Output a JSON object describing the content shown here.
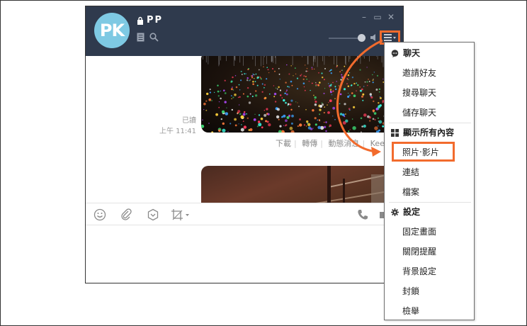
{
  "window": {
    "avatar_text": "PK",
    "title": "PP",
    "minimize": "–",
    "maximize": "▭",
    "close": "✕"
  },
  "chat": {
    "read_label": "已讀",
    "time_label": "上午 11:41",
    "actions": [
      "下載",
      "轉傳",
      "動態消息",
      "Keep"
    ]
  },
  "menu": {
    "sections": [
      {
        "header": "聊天",
        "icon": "chat-bubble-icon",
        "items": [
          "邀請好友",
          "搜尋聊天",
          "儲存聊天"
        ]
      },
      {
        "header": "顯示所有內容",
        "icon": "grid-icon",
        "items": [
          "照片‧影片",
          "連結",
          "檔案"
        ]
      },
      {
        "header": "設定",
        "icon": "gear-icon",
        "items": [
          "固定畫面",
          "關閉提醒",
          "背景設定",
          "封鎖",
          "檢舉"
        ]
      }
    ]
  },
  "colors": {
    "titlebar": "#2f3a4d",
    "highlight": "#f26b2d",
    "avatar": "#7ec9e3"
  }
}
